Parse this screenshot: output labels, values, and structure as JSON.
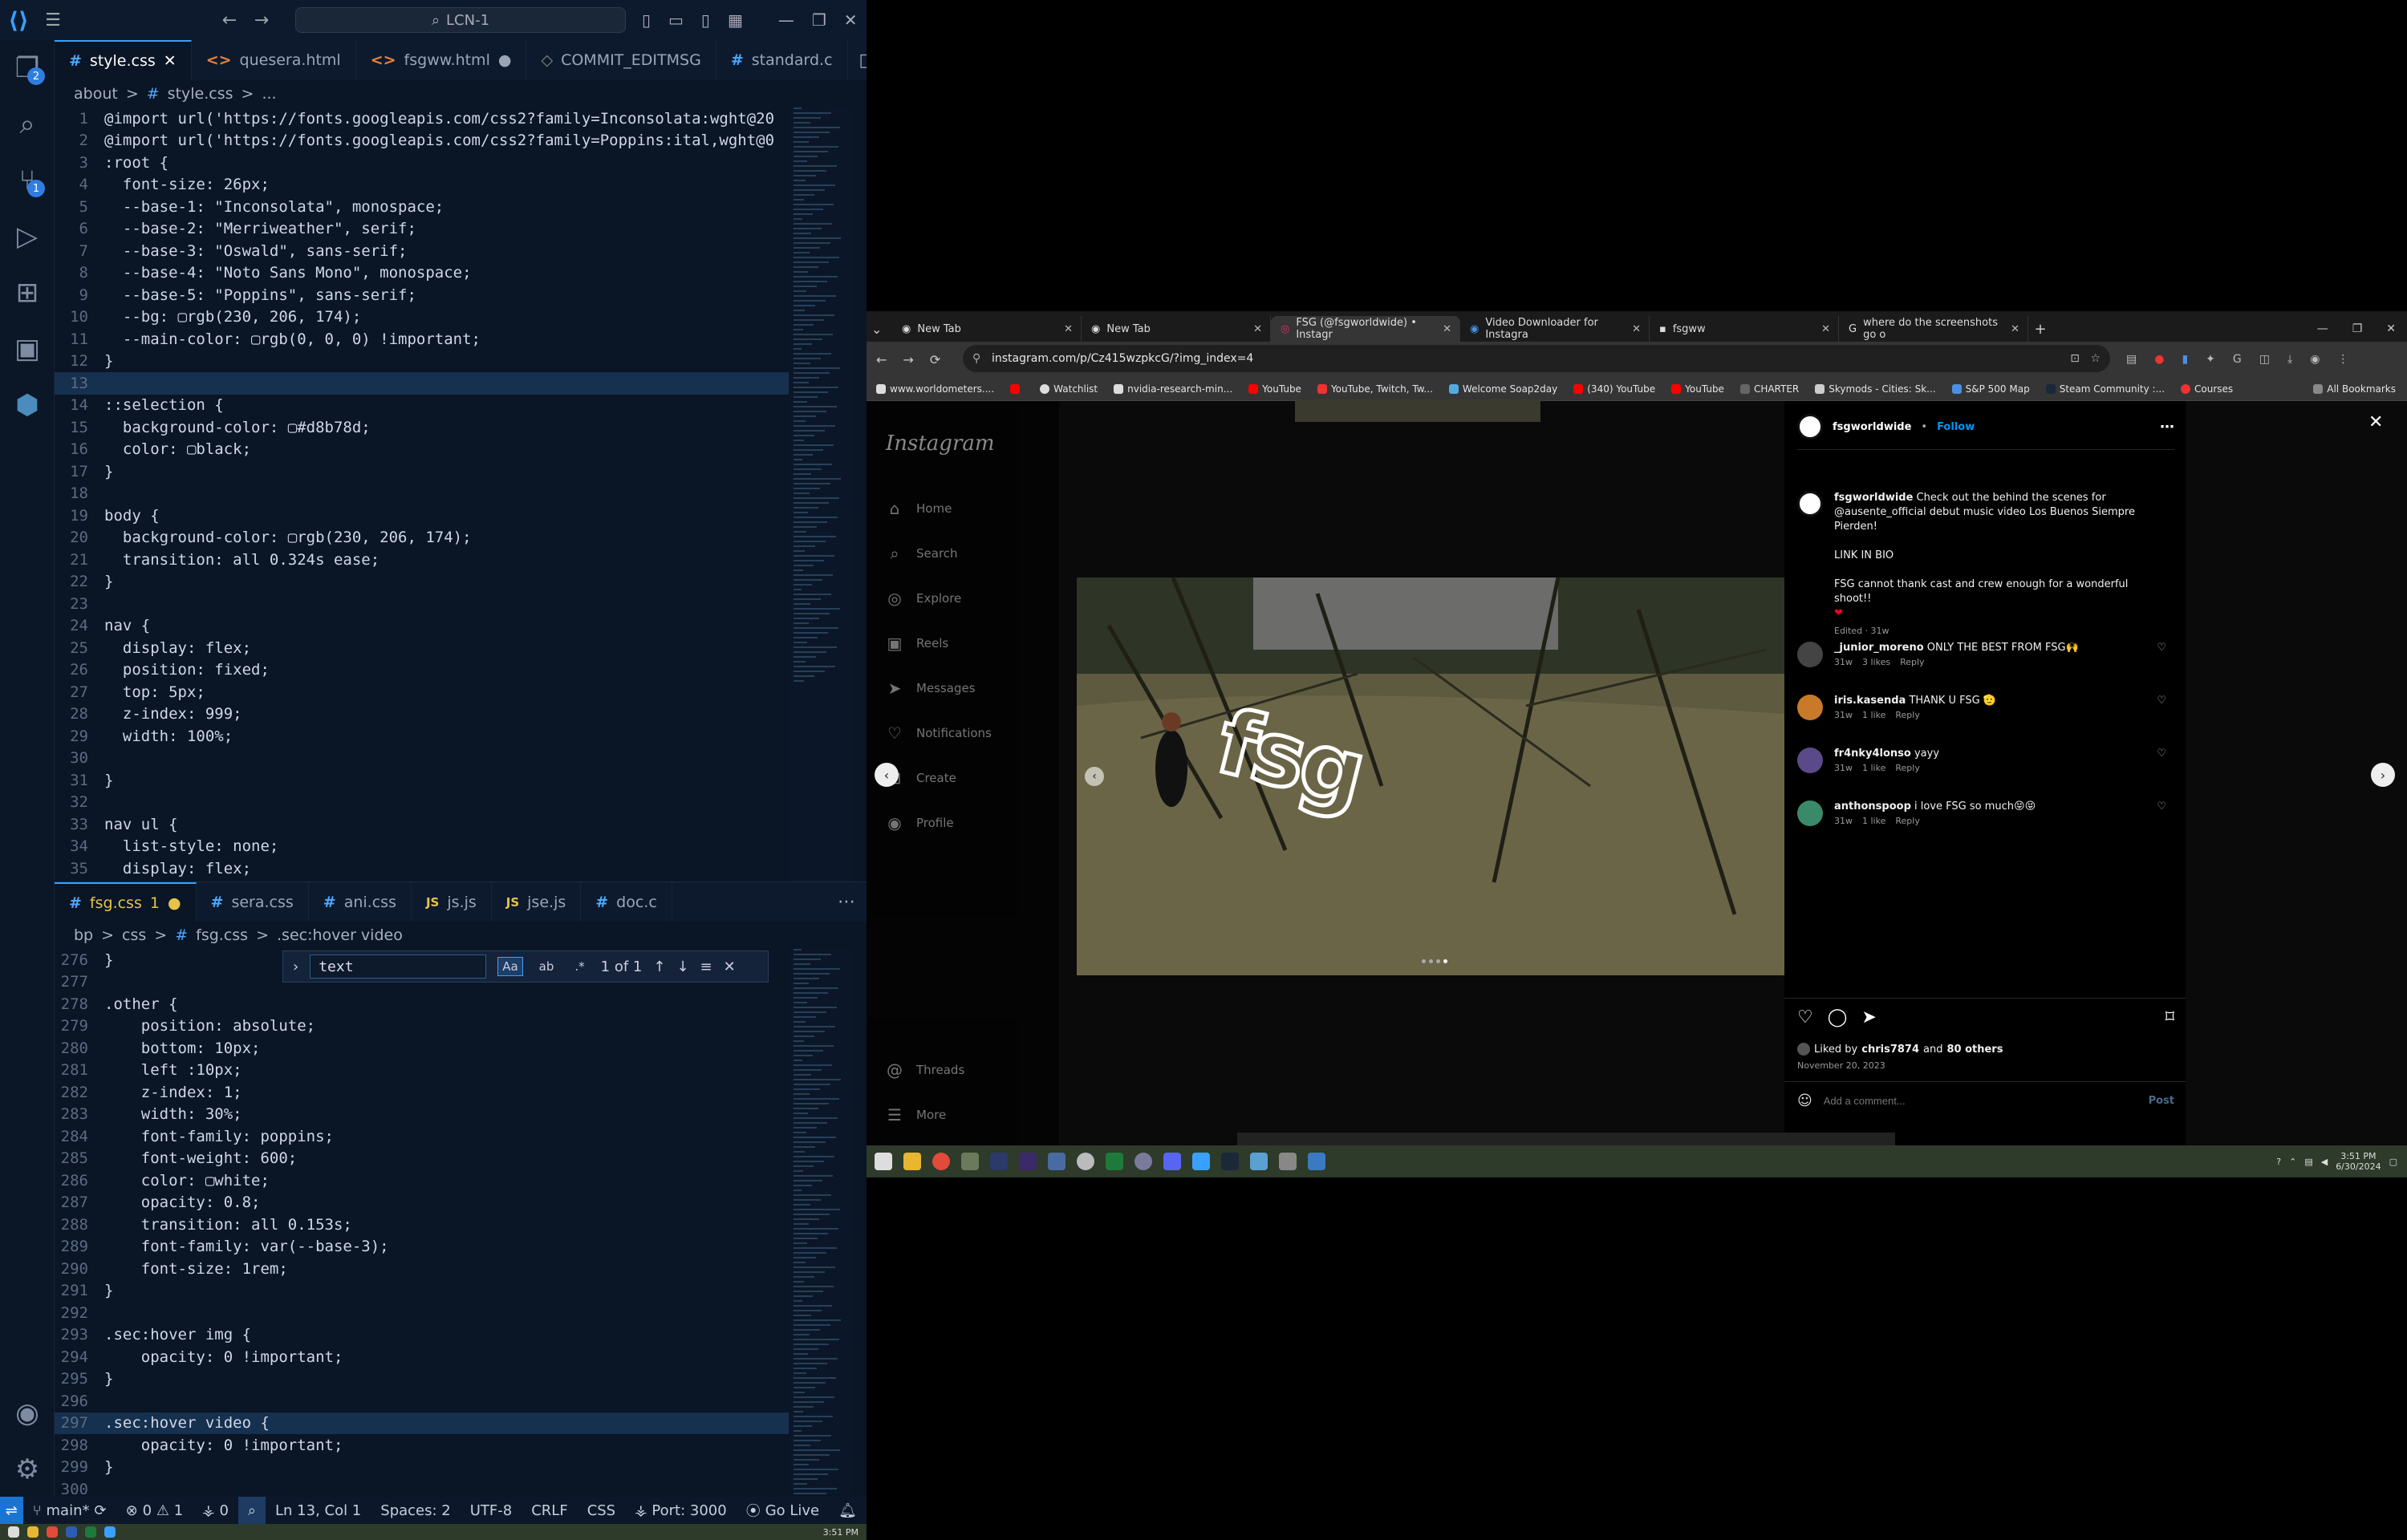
{
  "vscode": {
    "command_center": "LCN-1",
    "explorer_badge": "2",
    "scm_badge": "1",
    "top_tabs": [
      {
        "label": "style.css",
        "icon": "#"
      },
      {
        "label": "quesera.html",
        "icon": "<>"
      },
      {
        "label": "fsgww.html",
        "icon": "<>"
      },
      {
        "label": "COMMIT_EDITMSG",
        "icon": "◇"
      },
      {
        "label": "standard.c",
        "icon": "#"
      }
    ],
    "top_breadcrumb": [
      "about",
      ">",
      "#",
      "style.css",
      ">",
      "..."
    ],
    "top_lines": [
      {
        "n": "1",
        "t": "@import url('https://fonts.googleapis.com/css2?family=Inconsolata:wght@20"
      },
      {
        "n": "2",
        "t": "@import url('https://fonts.googleapis.com/css2?family=Poppins:ital,wght@0"
      },
      {
        "n": "3",
        "t": ":root {"
      },
      {
        "n": "4",
        "t": "  font-size: 26px;"
      },
      {
        "n": "5",
        "t": "  --base-1: \"Inconsolata\", monospace;"
      },
      {
        "n": "6",
        "t": "  --base-2: \"Merriweather\", serif;"
      },
      {
        "n": "7",
        "t": "  --base-3: \"Oswald\", sans-serif;"
      },
      {
        "n": "8",
        "t": "  --base-4: \"Noto Sans Mono\", monospace;"
      },
      {
        "n": "9",
        "t": "  --base-5: \"Poppins\", sans-serif;"
      },
      {
        "n": "10",
        "t": "  --bg: ▢rgb(230, 206, 174);"
      },
      {
        "n": "11",
        "t": "  --main-color: ▢rgb(0, 0, 0) !important;"
      },
      {
        "n": "12",
        "t": "}"
      },
      {
        "n": "13",
        "t": ""
      },
      {
        "n": "14",
        "t": "::selection {"
      },
      {
        "n": "15",
        "t": "  background-color: ▢#d8b78d;"
      },
      {
        "n": "16",
        "t": "  color: ▢black;"
      },
      {
        "n": "17",
        "t": "}"
      },
      {
        "n": "18",
        "t": ""
      },
      {
        "n": "19",
        "t": "body {"
      },
      {
        "n": "20",
        "t": "  background-color: ▢rgb(230, 206, 174);"
      },
      {
        "n": "21",
        "t": "  transition: all 0.324s ease;"
      },
      {
        "n": "22",
        "t": "}"
      },
      {
        "n": "23",
        "t": ""
      },
      {
        "n": "24",
        "t": "nav {"
      },
      {
        "n": "25",
        "t": "  display: flex;"
      },
      {
        "n": "26",
        "t": "  position: fixed;"
      },
      {
        "n": "27",
        "t": "  top: 5px;"
      },
      {
        "n": "28",
        "t": "  z-index: 999;"
      },
      {
        "n": "29",
        "t": "  width: 100%;"
      },
      {
        "n": "30",
        "t": ""
      },
      {
        "n": "31",
        "t": "}"
      },
      {
        "n": "32",
        "t": ""
      },
      {
        "n": "33",
        "t": "nav ul {"
      },
      {
        "n": "34",
        "t": "  list-style: none;"
      },
      {
        "n": "35",
        "t": "  display: flex;"
      }
    ],
    "bottom_tabs": [
      {
        "label": "fsg.css",
        "icon": "#",
        "extra": "1"
      },
      {
        "label": "sera.css",
        "icon": "#"
      },
      {
        "label": "ani.css",
        "icon": "#"
      },
      {
        "label": "js.js",
        "icon": "JS"
      },
      {
        "label": "jse.js",
        "icon": "JS"
      },
      {
        "label": "doc.c",
        "icon": "#"
      }
    ],
    "bottom_breadcrumb": [
      "bp",
      ">",
      "css",
      ">",
      "#",
      "fsg.css",
      ">",
      ".sec:hover video"
    ],
    "find": {
      "value": "text",
      "result": "1 of 1",
      "opt_case": "Aa",
      "opt_word": "ab",
      "opt_regex": ".*"
    },
    "bottom_lines": [
      {
        "n": "276",
        "t": "}"
      },
      {
        "n": "277",
        "t": ""
      },
      {
        "n": "278",
        "t": ".other {"
      },
      {
        "n": "279",
        "t": "    position: absolute;"
      },
      {
        "n": "280",
        "t": "    bottom: 10px;"
      },
      {
        "n": "281",
        "t": "    left :10px;"
      },
      {
        "n": "282",
        "t": "    z-index: 1;"
      },
      {
        "n": "283",
        "t": "    width: 30%;"
      },
      {
        "n": "284",
        "t": "    font-family: poppins;"
      },
      {
        "n": "285",
        "t": "    font-weight: 600;"
      },
      {
        "n": "286",
        "t": "    color: ▢white;"
      },
      {
        "n": "287",
        "t": "    opacity: 0.8;"
      },
      {
        "n": "288",
        "t": "    transition: all 0.153s;"
      },
      {
        "n": "289",
        "t": "    font-family: var(--base-3);"
      },
      {
        "n": "290",
        "t": "    font-size: 1rem;"
      },
      {
        "n": "291",
        "t": "}"
      },
      {
        "n": "292",
        "t": ""
      },
      {
        "n": "293",
        "t": ".sec:hover img {"
      },
      {
        "n": "294",
        "t": "    opacity: 0 !important;"
      },
      {
        "n": "295",
        "t": "}"
      },
      {
        "n": "296",
        "t": ""
      },
      {
        "n": "297",
        "t": ".sec:hover video {"
      },
      {
        "n": "298",
        "t": "    opacity: 0 !important;"
      },
      {
        "n": "299",
        "t": "}"
      },
      {
        "n": "300",
        "t": ""
      }
    ],
    "status": {
      "branch": "main*",
      "problems": "0 ⚠ 1",
      "ports": "0",
      "position": "Ln 13, Col 1",
      "spaces": "Spaces: 2",
      "encoding": "UTF-8",
      "eol": "CRLF",
      "lang": "CSS",
      "port": "Port: 3000",
      "golive": "Go Live"
    },
    "taskbar_time": "3:51 PM"
  },
  "chrome": {
    "tabs": [
      "New Tab",
      "New Tab",
      "FSG (@fsgworldwide) • Instagr",
      "Video Downloader for Instagra",
      "fsgww",
      "where do the screenshots go o"
    ],
    "url": "instagram.com/p/Cz415wzpkcG/?img_index=4",
    "bookmarks": [
      "www.worldometers....",
      "",
      "Watchlist",
      "nvidia-research-min...",
      "YouTube",
      "YouTube, Twitch, Tw...",
      "Welcome Soap2day",
      "(340) YouTube",
      "YouTube",
      "CHARTER",
      "Skymods - Cities: Sk...",
      "S&P 500 Map",
      "Steam Community :...",
      "Courses"
    ],
    "all_bookmarks": "All Bookmarks",
    "colors": {
      "accent": "#0095f6",
      "toolbar": "#353535"
    }
  },
  "instagram": {
    "logo": "Instagram",
    "nav": [
      {
        "icon": "home-icon",
        "label": "Home"
      },
      {
        "icon": "search-icon",
        "label": "Search"
      },
      {
        "icon": "explore-icon",
        "label": "Explore"
      },
      {
        "icon": "reels-icon",
        "label": "Reels"
      },
      {
        "icon": "messages-icon",
        "label": "Messages"
      },
      {
        "icon": "notifications-icon",
        "label": "Notifications"
      },
      {
        "icon": "create-icon",
        "label": "Create"
      },
      {
        "icon": "profile-icon",
        "label": "Profile"
      }
    ],
    "threads": "Threads",
    "more": "More",
    "post": {
      "username": "fsgworldwide",
      "follow": "Follow",
      "caption_user": "fsgworldwide",
      "caption": "Check out the behind the scenes for @ausente_official debut music video Los Buenos Siempre Pierden!",
      "link_in_bio": "LINK IN BIO",
      "thanks": "FSG cannot thank cast and crew enough for a wonderful shoot!!",
      "edited": "Edited · 31w",
      "comments": [
        {
          "user": "_junior_moreno",
          "text": "ONLY THE BEST FROM FSG🙌",
          "age": "31w",
          "likes": "3 likes",
          "reply": "Reply"
        },
        {
          "user": "iris.kasenda",
          "text": "THANK U FSG 🫡",
          "age": "31w",
          "likes": "1 like",
          "reply": "Reply"
        },
        {
          "user": "fr4nky4lonso",
          "text": "yayy",
          "age": "31w",
          "likes": "1 like",
          "reply": "Reply"
        },
        {
          "user": "anthonspoop",
          "text": "i love FSG so much😝😝",
          "age": "31w",
          "likes": "1 like",
          "reply": "Reply"
        }
      ],
      "liked_by_prefix": "Liked by",
      "liked_by_user": "chris7874",
      "liked_by_and": "and",
      "liked_by_others": "80 others",
      "date": "November 20, 2023",
      "comment_placeholder": "Add a comment...",
      "post_btn": "Post",
      "media_text": "fsg"
    },
    "tray_time": "3:51 PM",
    "tray_date": "6/30/2024"
  }
}
